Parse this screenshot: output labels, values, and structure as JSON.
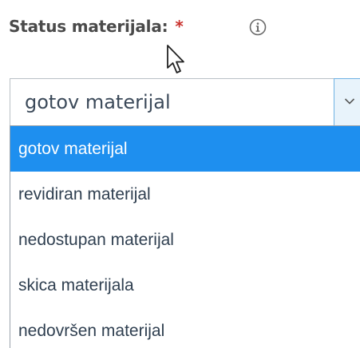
{
  "field": {
    "label": "Status materijala:",
    "required_marker": "*",
    "info_icon": "info-circle-icon"
  },
  "select": {
    "value": "gotov materijal",
    "toggle_icon": "chevron-down-icon"
  },
  "dropdown": {
    "options": [
      {
        "label": "gotov materijal",
        "selected": true
      },
      {
        "label": "revidiran materijal",
        "selected": false
      },
      {
        "label": "nedostupan materijal",
        "selected": false
      },
      {
        "label": "skica materijala",
        "selected": false
      },
      {
        "label": "nedovršen materijal",
        "selected": false
      }
    ]
  },
  "colors": {
    "selected_option_bg": "#1e8fef",
    "required_star": "#c9302c",
    "toggle_bg": "#e8f3fb",
    "toggle_border": "#6fb2e3"
  }
}
